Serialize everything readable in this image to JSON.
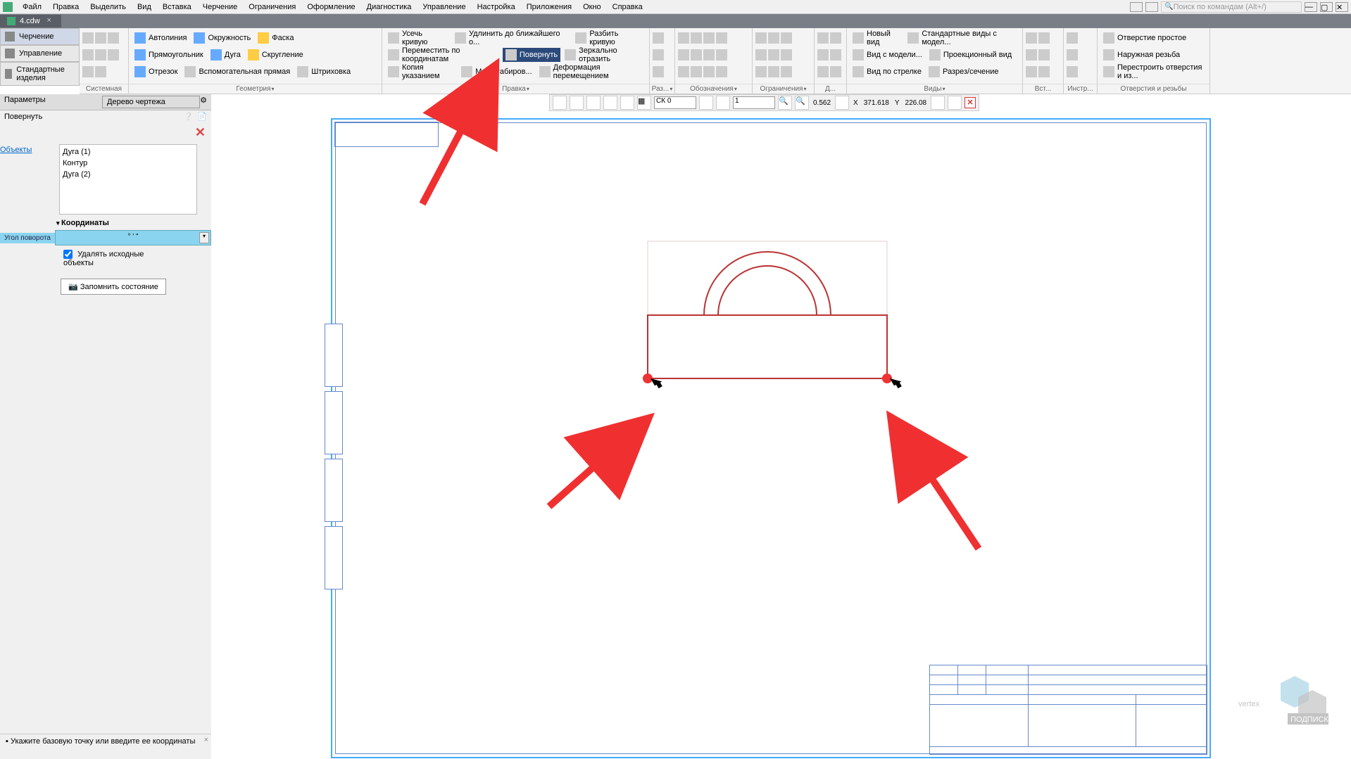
{
  "menu": {
    "items": [
      "Файл",
      "Правка",
      "Выделить",
      "Вид",
      "Вставка",
      "Черчение",
      "Ограничения",
      "Оформление",
      "Диагностика",
      "Управление",
      "Настройка",
      "Приложения",
      "Окно",
      "Справка"
    ],
    "search_ph": "Поиск по командам (Alt+/)"
  },
  "tab": {
    "name": "4.cdw"
  },
  "modebar": {
    "items": [
      "Черчение",
      "Управление",
      "Стандартные изделия"
    ]
  },
  "ribbon": {
    "sys": {
      "label": "Системная"
    },
    "geom": {
      "label": "Геометрия",
      "autoline": "Автолиния",
      "circle": "Окружность",
      "chamfer": "Фаска",
      "rect": "Прямоугольник",
      "arc": "Дуга",
      "fillet": "Скругление",
      "segment": "Отрезок",
      "auxline": "Вспомогательная прямая",
      "hatch": "Штриховка"
    },
    "edit": {
      "label": "Правка",
      "trim": "Усечь кривую",
      "extend": "Удлинить до ближайшего о...",
      "split": "Разбить кривую",
      "move": "Переместить по координатам",
      "rotate": "Повернуть",
      "mirror": "Зеркально отразить",
      "copy": "Копия указанием",
      "scale": "Масштабиров...",
      "deform": "Деформация перемещением"
    },
    "dim": {
      "label": "Раз..."
    },
    "annot": {
      "label": "Обозначения"
    },
    "constr": {
      "label": "Ограничения"
    },
    "diag": {
      "label": "Д..."
    },
    "views": {
      "label": "Виды",
      "newview": "Новый вид",
      "modelview": "Вид с модели...",
      "arrowview": "Вид по стрелке",
      "stdviews": "Стандартные виды с модел...",
      "projview": "Проекционный вид",
      "section": "Разрез/сечение"
    },
    "insert": {
      "label": "Вст..."
    },
    "tools": {
      "label": "Инстр..."
    },
    "holes": {
      "label": "Отверстия и резьбы",
      "simple": "Отверстие простое",
      "ext": "Наружная резьба",
      "rebuild": "Перестроить отверстия и из..."
    }
  },
  "canvbar": {
    "cs": "СК 0",
    "scale": "1",
    "zoom": "0.562",
    "x": "371.618",
    "y": "226.08",
    "xl": "X",
    "yl": "Y"
  },
  "panel": {
    "title": "Параметры",
    "tree": "Дерево чертежа",
    "sub": "Повернуть",
    "obj_link": "Объекты",
    "objs": [
      "Дуга (1)",
      "Контур",
      "Дуга (2)"
    ],
    "coord": "Координаты",
    "ang_label": "Угол поворота",
    "ang_marks": "°            '            \"",
    "del_src": "Удалять исходные объекты",
    "save_state": "Запомнить состояние"
  },
  "status": {
    "msg": "Укажите базовую точку или введите ее координаты"
  },
  "watermark": {
    "brand": "vertex",
    "sub": "ПОДПИСКА"
  }
}
